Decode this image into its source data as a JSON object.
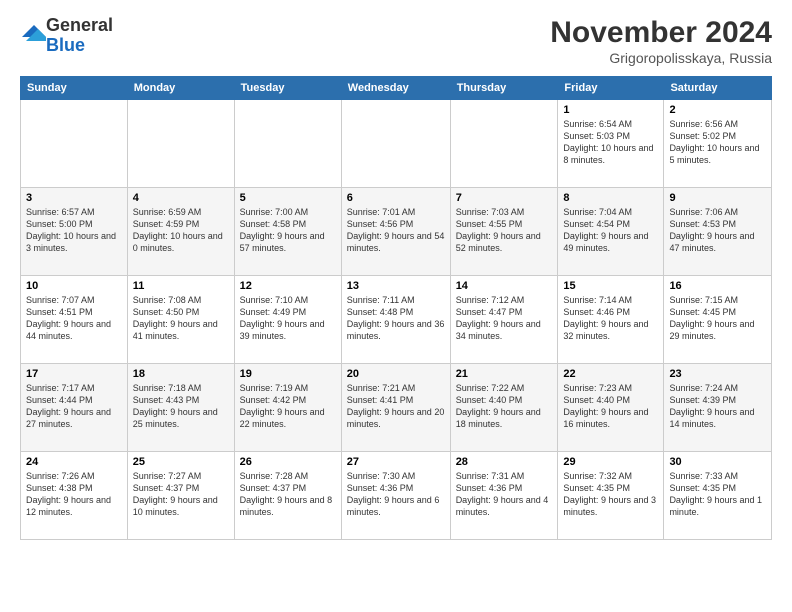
{
  "logo": {
    "general": "General",
    "blue": "Blue"
  },
  "title": "November 2024",
  "location": "Grigoropolisskaya, Russia",
  "days_header": [
    "Sunday",
    "Monday",
    "Tuesday",
    "Wednesday",
    "Thursday",
    "Friday",
    "Saturday"
  ],
  "weeks": [
    [
      {
        "day": "",
        "info": ""
      },
      {
        "day": "",
        "info": ""
      },
      {
        "day": "",
        "info": ""
      },
      {
        "day": "",
        "info": ""
      },
      {
        "day": "",
        "info": ""
      },
      {
        "day": "1",
        "info": "Sunrise: 6:54 AM\nSunset: 5:03 PM\nDaylight: 10 hours and 8 minutes."
      },
      {
        "day": "2",
        "info": "Sunrise: 6:56 AM\nSunset: 5:02 PM\nDaylight: 10 hours and 5 minutes."
      }
    ],
    [
      {
        "day": "3",
        "info": "Sunrise: 6:57 AM\nSunset: 5:00 PM\nDaylight: 10 hours and 3 minutes."
      },
      {
        "day": "4",
        "info": "Sunrise: 6:59 AM\nSunset: 4:59 PM\nDaylight: 10 hours and 0 minutes."
      },
      {
        "day": "5",
        "info": "Sunrise: 7:00 AM\nSunset: 4:58 PM\nDaylight: 9 hours and 57 minutes."
      },
      {
        "day": "6",
        "info": "Sunrise: 7:01 AM\nSunset: 4:56 PM\nDaylight: 9 hours and 54 minutes."
      },
      {
        "day": "7",
        "info": "Sunrise: 7:03 AM\nSunset: 4:55 PM\nDaylight: 9 hours and 52 minutes."
      },
      {
        "day": "8",
        "info": "Sunrise: 7:04 AM\nSunset: 4:54 PM\nDaylight: 9 hours and 49 minutes."
      },
      {
        "day": "9",
        "info": "Sunrise: 7:06 AM\nSunset: 4:53 PM\nDaylight: 9 hours and 47 minutes."
      }
    ],
    [
      {
        "day": "10",
        "info": "Sunrise: 7:07 AM\nSunset: 4:51 PM\nDaylight: 9 hours and 44 minutes."
      },
      {
        "day": "11",
        "info": "Sunrise: 7:08 AM\nSunset: 4:50 PM\nDaylight: 9 hours and 41 minutes."
      },
      {
        "day": "12",
        "info": "Sunrise: 7:10 AM\nSunset: 4:49 PM\nDaylight: 9 hours and 39 minutes."
      },
      {
        "day": "13",
        "info": "Sunrise: 7:11 AM\nSunset: 4:48 PM\nDaylight: 9 hours and 36 minutes."
      },
      {
        "day": "14",
        "info": "Sunrise: 7:12 AM\nSunset: 4:47 PM\nDaylight: 9 hours and 34 minutes."
      },
      {
        "day": "15",
        "info": "Sunrise: 7:14 AM\nSunset: 4:46 PM\nDaylight: 9 hours and 32 minutes."
      },
      {
        "day": "16",
        "info": "Sunrise: 7:15 AM\nSunset: 4:45 PM\nDaylight: 9 hours and 29 minutes."
      }
    ],
    [
      {
        "day": "17",
        "info": "Sunrise: 7:17 AM\nSunset: 4:44 PM\nDaylight: 9 hours and 27 minutes."
      },
      {
        "day": "18",
        "info": "Sunrise: 7:18 AM\nSunset: 4:43 PM\nDaylight: 9 hours and 25 minutes."
      },
      {
        "day": "19",
        "info": "Sunrise: 7:19 AM\nSunset: 4:42 PM\nDaylight: 9 hours and 22 minutes."
      },
      {
        "day": "20",
        "info": "Sunrise: 7:21 AM\nSunset: 4:41 PM\nDaylight: 9 hours and 20 minutes."
      },
      {
        "day": "21",
        "info": "Sunrise: 7:22 AM\nSunset: 4:40 PM\nDaylight: 9 hours and 18 minutes."
      },
      {
        "day": "22",
        "info": "Sunrise: 7:23 AM\nSunset: 4:40 PM\nDaylight: 9 hours and 16 minutes."
      },
      {
        "day": "23",
        "info": "Sunrise: 7:24 AM\nSunset: 4:39 PM\nDaylight: 9 hours and 14 minutes."
      }
    ],
    [
      {
        "day": "24",
        "info": "Sunrise: 7:26 AM\nSunset: 4:38 PM\nDaylight: 9 hours and 12 minutes."
      },
      {
        "day": "25",
        "info": "Sunrise: 7:27 AM\nSunset: 4:37 PM\nDaylight: 9 hours and 10 minutes."
      },
      {
        "day": "26",
        "info": "Sunrise: 7:28 AM\nSunset: 4:37 PM\nDaylight: 9 hours and 8 minutes."
      },
      {
        "day": "27",
        "info": "Sunrise: 7:30 AM\nSunset: 4:36 PM\nDaylight: 9 hours and 6 minutes."
      },
      {
        "day": "28",
        "info": "Sunrise: 7:31 AM\nSunset: 4:36 PM\nDaylight: 9 hours and 4 minutes."
      },
      {
        "day": "29",
        "info": "Sunrise: 7:32 AM\nSunset: 4:35 PM\nDaylight: 9 hours and 3 minutes."
      },
      {
        "day": "30",
        "info": "Sunrise: 7:33 AM\nSunset: 4:35 PM\nDaylight: 9 hours and 1 minute."
      }
    ]
  ]
}
